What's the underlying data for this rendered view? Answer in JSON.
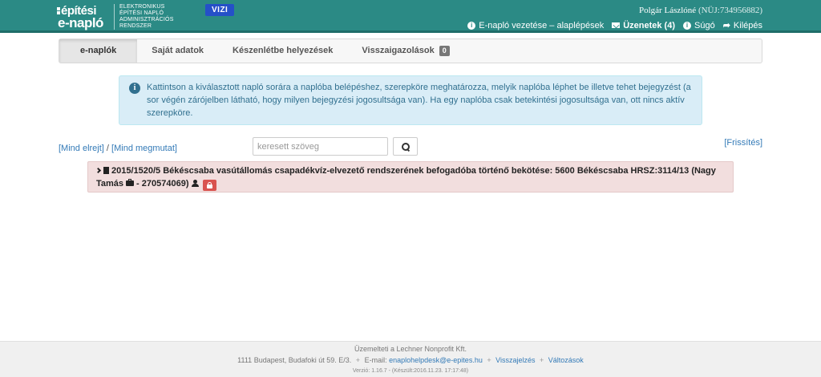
{
  "header": {
    "logo_line1": "építési",
    "logo_line2": "e-napló",
    "logo_sub": [
      "ELEKTRONIKUS",
      "ÉPÍTÉSI NAPLÓ",
      "ADMINISZTRÁCIÓS",
      "RENDSZER"
    ],
    "env_badge": "VIZI",
    "user_name": "Polgár Lászlóné",
    "user_id": "(NÜJ:734956882)",
    "links": {
      "help_basics": "E-napló vezetése – alaplépések",
      "messages": "Üzenetek (4)",
      "help": "Súgó",
      "logout": "Kilépés"
    }
  },
  "tabs": [
    {
      "label": "e-naplók",
      "active": true
    },
    {
      "label": "Saját adatok",
      "active": false
    },
    {
      "label": "Készenlétbe helyezések",
      "active": false
    },
    {
      "label": "Visszaigazolások",
      "active": false,
      "badge": "0"
    }
  ],
  "info": {
    "text": "Kattintson a kiválasztott napló sorára a naplóba belépéshez, szerepköre meghatározza, melyik naplóba léphet be illetve tehet bejegyzést (a sor végén zárójelben látható, hogy milyen bejegyzési jogosultsága van). Ha egy naplóba csak betekintési jogosultsága van, ott nincs aktív szerepköre."
  },
  "controls": {
    "hide_all": "[Mind elrejt]",
    "separator": "/",
    "show_all": "[Mind megmutat]",
    "search_placeholder": "keresett szöveg",
    "search_value": "",
    "refresh": "[Frissítés]"
  },
  "diary": {
    "text": "2015/1520/5 Békéscsaba vasútállomás csapadékvíz-elvezető rendszerének befogadóba történő bekötése: 5600 Békéscsaba HRSZ:3114/13 (Nagy Tamás",
    "suffix": "- 270574069)"
  },
  "footer": {
    "operator": "Üzemelteti a Lechner Nonprofit Kft.",
    "address": "1111 Budapest, Budafoki út 59. E/3.",
    "email_label": "E-mail:",
    "email": "enaplohelpdesk@e-epites.hu",
    "feedback": "Visszajelzés",
    "changes": "Változások",
    "version": "Verzió: 1.16.7 - (Készült:2016.11.23. 17:17:48)"
  }
}
